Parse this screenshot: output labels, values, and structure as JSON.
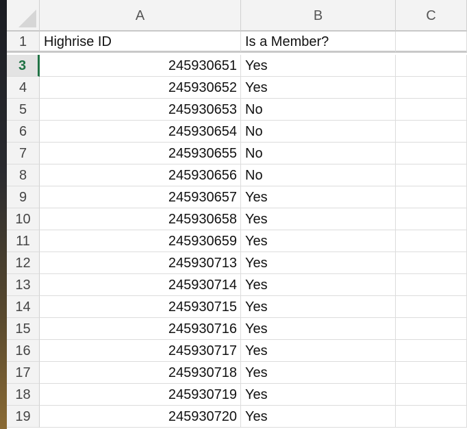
{
  "columns": [
    "A",
    "B",
    "C"
  ],
  "header_row": {
    "row_number": "1",
    "col_a": "Highrise ID",
    "col_b": "Is a Member?",
    "col_c": ""
  },
  "active_row": "3",
  "rows": [
    {
      "row": "3",
      "id": "245930651",
      "member": "Yes"
    },
    {
      "row": "4",
      "id": "245930652",
      "member": "Yes"
    },
    {
      "row": "5",
      "id": "245930653",
      "member": "No"
    },
    {
      "row": "6",
      "id": "245930654",
      "member": "No"
    },
    {
      "row": "7",
      "id": "245930655",
      "member": "No"
    },
    {
      "row": "8",
      "id": "245930656",
      "member": "No"
    },
    {
      "row": "9",
      "id": "245930657",
      "member": "Yes"
    },
    {
      "row": "10",
      "id": "245930658",
      "member": "Yes"
    },
    {
      "row": "11",
      "id": "245930659",
      "member": "Yes"
    },
    {
      "row": "12",
      "id": "245930713",
      "member": "Yes"
    },
    {
      "row": "13",
      "id": "245930714",
      "member": "Yes"
    },
    {
      "row": "14",
      "id": "245930715",
      "member": "Yes"
    },
    {
      "row": "15",
      "id": "245930716",
      "member": "Yes"
    },
    {
      "row": "16",
      "id": "245930717",
      "member": "Yes"
    },
    {
      "row": "17",
      "id": "245930718",
      "member": "Yes"
    },
    {
      "row": "18",
      "id": "245930719",
      "member": "Yes"
    },
    {
      "row": "19",
      "id": "245930720",
      "member": "Yes"
    }
  ],
  "colors": {
    "accent": "#217346",
    "header_bg": "#f3f3f3",
    "grid": "#dcdcdc"
  }
}
